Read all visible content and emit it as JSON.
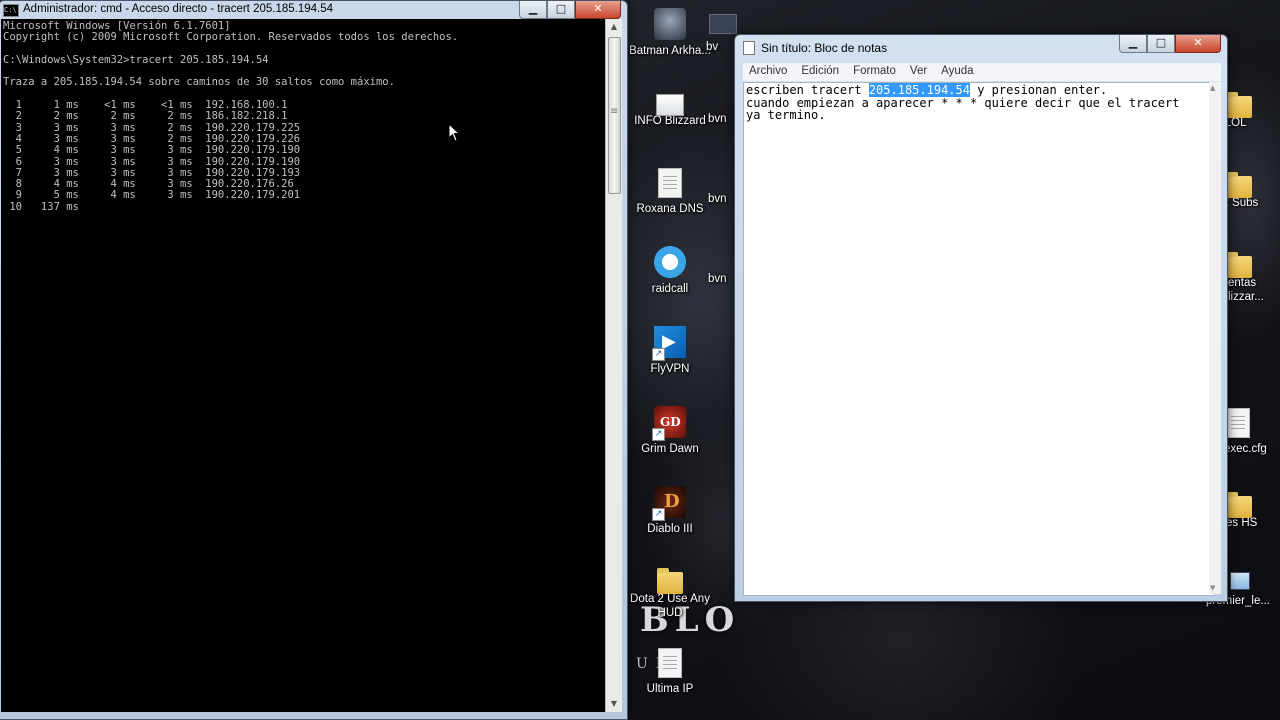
{
  "cmd": {
    "title": "Administrador: cmd - Acceso directo - tracert  205.185.194.54",
    "icon_label": "C:\\",
    "output": "Microsoft Windows [Versión 6.1.7601]\nCopyright (c) 2009 Microsoft Corporation. Reservados todos los derechos.\n\nC:\\Windows\\System32>tracert 205.185.194.54\n\nTraza a 205.185.194.54 sobre caminos de 30 saltos como máximo.\n\n  1     1 ms    <1 ms    <1 ms  192.168.100.1\n  2     2 ms     2 ms     2 ms  186.182.218.1\n  3     3 ms     3 ms     2 ms  190.220.179.225\n  4     3 ms     3 ms     2 ms  190.220.179.226\n  5     4 ms     3 ms     3 ms  190.220.179.190\n  6     3 ms     3 ms     3 ms  190.220.179.190\n  7     3 ms     3 ms     3 ms  190.220.179.193\n  8     4 ms     4 ms     3 ms  190.220.176.26\n  9     5 ms     4 ms     3 ms  190.220.179.201\n 10   137 ms"
  },
  "notepad": {
    "title": "Sin título: Bloc de notas",
    "menu": [
      "Archivo",
      "Edición",
      "Formato",
      "Ver",
      "Ayuda"
    ],
    "text_before": "escriben tracert ",
    "text_selected": "205.185.194.54",
    "text_after": " y presionan enter.\ncuando empiezan a aparecer * * * quiere decir que el tracert\nya termino."
  },
  "window_buttons": {
    "minimize": "▁",
    "maximize": "□",
    "close": "✕"
  },
  "desktop": {
    "icons": [
      {
        "label": "Batman Arkha...",
        "icon": "batman-icon"
      },
      {
        "label": "INFO Blizzard",
        "icon": "document-icon"
      },
      {
        "label": "Roxana DNS",
        "icon": "text-file-icon"
      },
      {
        "label": "raidcall",
        "icon": "raidcall-icon"
      },
      {
        "label": "FlyVPN",
        "icon": "flyvpn-icon"
      },
      {
        "label": "Grim Dawn",
        "icon": "grim-dawn-icon"
      },
      {
        "label": "Diablo III",
        "icon": "diablo-icon"
      },
      {
        "label": "Dota 2 Use Any HUD",
        "icon": "folder-icon"
      },
      {
        "label": "Ultima IP",
        "icon": "text-file-icon"
      }
    ],
    "partial_icons": [
      "bv",
      "bvn",
      "bvn",
      "bvn"
    ],
    "right_icons": [
      {
        "label": "ta LOL",
        "icon": "folder-icon"
      },
      {
        "label": "lix Subs",
        "icon": "folder-icon"
      },
      {
        "label": "entas lizzar...",
        "icon": "folder-icon"
      },
      {
        "label": "exec.cfg",
        "icon": "text-file-icon"
      },
      {
        "label": "es HS",
        "icon": "folder-icon"
      },
      {
        "label": "premier_le...",
        "icon": "premier-icon"
      }
    ],
    "wallpaper_text": "BLO",
    "wallpaper_sub": "ULS"
  }
}
